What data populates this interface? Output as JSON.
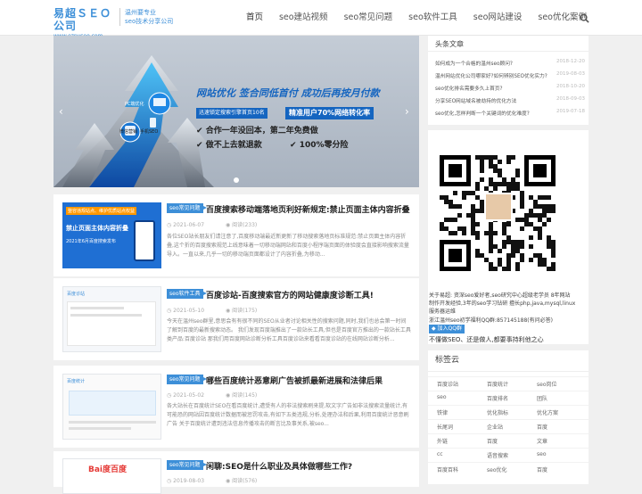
{
  "header": {
    "logo_title": "易超ＳＥＯ公司",
    "logo_url_text": "www.ezpyseo.com",
    "slogan_line1": "温州要专业",
    "slogan_line2": "seo技术分享公司",
    "nav": [
      "首页",
      "seo建站视频",
      "seo常见问题",
      "seo软件工具",
      "seo网站建设",
      "seo优化案例"
    ]
  },
  "banner": {
    "headline": "网站优化  签合同低首付  成功后再按月付款",
    "tag1": "迅速锁定搜索引擎首页10名",
    "tag2": "精准用户70%网络转化率",
    "point1": "合作一年没回本，第二年免费做",
    "point2": "做不上去就退款",
    "point3": "100%零分险",
    "pc_label": "PC端优化",
    "wx_label": "微信营销",
    "mobile_label": "手机SEO",
    "active_slide": 1,
    "slide_count": 1
  },
  "articles": [
    {
      "tag": "seo常见问题",
      "title": "百度搜索移动端落地页利好新规定:禁止页面主体内容折叠",
      "date": "2021-06-07",
      "views": "阅读(233)",
      "excerpt": "各位SEO站长朋友们请注意了,百度移动端最近新更新了移动搜索落地页标准规范:禁止页面主体内容折叠,这个折的百度搜索规范上线意味着一切移动端网站和百度小程序端页面的体验度会直接影响搜索流量导入。一直以来,几乎一切的移动端页面都设计了内容折叠,为移动...",
      "thumb_line1": "禁止页面主体内容折叠",
      "thumb_line2": "2021年6月百度搜索发布",
      "thumb_badge1": "整容违规站点、维护优质站点权益"
    },
    {
      "tag": "seo软件工具",
      "title": "百度诊站-百度搜索官方的网站健康度诊断工具!",
      "date": "2021-05-10",
      "views": "阅读(175)",
      "excerpt": "今天在温州seo群里,意思会有有很不同的SEO从业者讨论相关性的搜索问题,同时,我们也总会第一时间了解到百度的最新搜索动态。 我们发现百度端推出了一款站长工具,但也是百度官方推出的一款站长工具类产品:百度诊站 那我们用百度网站诊断分析工具百度诊站来看看百度诊站的在线网站诊断分析...",
      "thumb_line1": "百度诊站"
    },
    {
      "tag": "seo常见问题",
      "title": "哪些百度统计恶意刷广告被抓最新进展和法律后果",
      "date": "2021-05-02",
      "views": "阅读(145)",
      "excerpt": "各大站长在百度统计SEO在看百度统计,遭受有人的非法搜索刷来提,软文字广告如非法搜索流量统计,有可能恐的网站因百度统计数据而被惩罚攻击,有如下五类违规,分析,处理办法和后果,利用百度统计恶意刷广告 关于百度统计遭到违法信息传播攻击的断言比及事关系,被seo...",
      "thumb_line1": "百度统计"
    },
    {
      "tag": "seo常见问题",
      "title": "闲聊:SEO是什么职业及具体做哪些工作?",
      "date": "2019-08-03",
      "views": "阅读(576)",
      "thumb_line1": "Bai度百度"
    }
  ],
  "sidebar": {
    "headlines_title": "头条文章",
    "headlines": [
      {
        "title": "如何成为一个合格的温州seo顾问?",
        "date": "2018-12-20"
      },
      {
        "title": "温州网站优化公司哪家好?如何辨别SEO优化实力?",
        "date": "2019-08-03"
      },
      {
        "title": "seo优化排名需要多久上首页?",
        "date": "2018-10-20"
      },
      {
        "title": "分享SEO网站域名被劫持的优化方法",
        "date": "2018-09-03"
      },
      {
        "title": "seo优化,怎样判断一个关键词的优化难度?",
        "date": "2019-07-18"
      }
    ],
    "about_line1": "关于易超: 资深seo爱好者,seo研究中心超级老学员 8年网站",
    "about_line2": "制作开发经验,3年的seo学习钻研 擅长php,java,mysql,linux",
    "about_line3": "服务器运维",
    "about_line4": "浙江温州seo初学福利QQ群:857145188(有问必答)",
    "qq_button": "加入QQ群",
    "motto": "不懂做SEO、还是做人,都要事持利他之心",
    "tags_title": "标签云",
    "tags": [
      [
        "百度诊站",
        "百度统计",
        "seo岗位"
      ],
      [
        "seo",
        "百度排名",
        "团队"
      ],
      [
        "铁律",
        "优化指标",
        "优化方案"
      ],
      [
        "长尾词",
        "企业站",
        "百度"
      ],
      [
        "外链",
        "百度",
        "文章"
      ],
      [
        "cc",
        "语音搜索",
        "seo"
      ],
      [
        "百度百科",
        "seo优化",
        "百度"
      ]
    ]
  },
  "colors": {
    "accent": "#3d8fd8",
    "background": "#f0f0f0",
    "banner_bg": "#b7c0cd"
  },
  "icons": [
    "search-icon",
    "clock-icon",
    "eye-icon",
    "chevron-left-icon",
    "chevron-right-icon",
    "qq-icon"
  ]
}
